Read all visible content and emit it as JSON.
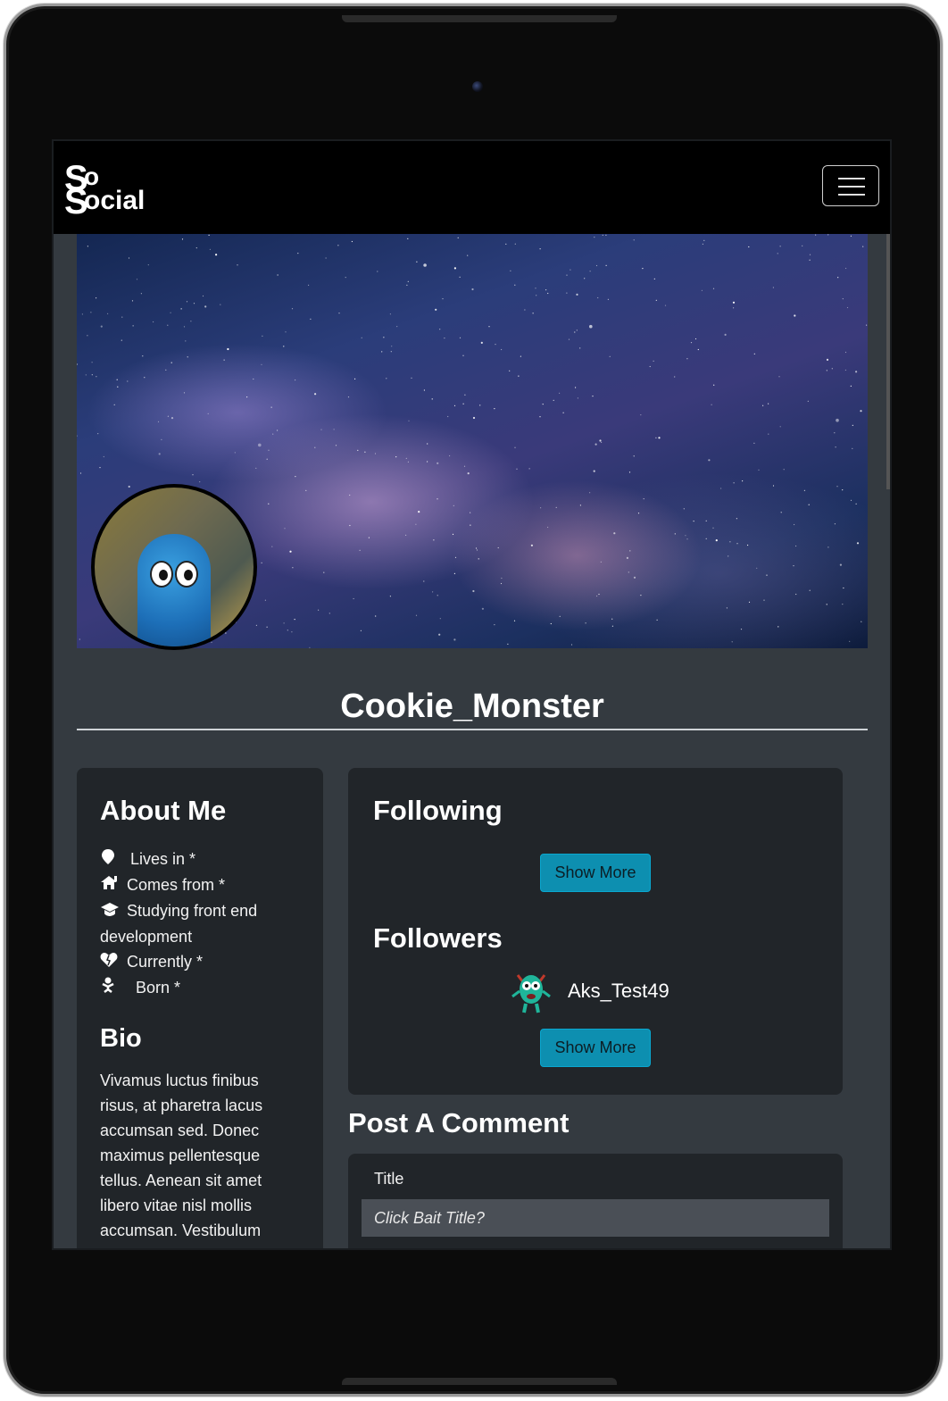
{
  "brand": {
    "logo_alt": "So Social"
  },
  "profile": {
    "username": "Cookie_Monster"
  },
  "about": {
    "title": "About Me",
    "items": [
      {
        "icon": "map-pin-icon",
        "label": "Lives in *"
      },
      {
        "icon": "home-icon",
        "label": "Comes from *"
      },
      {
        "icon": "graduation-cap-icon",
        "label": "Studying front end development"
      },
      {
        "icon": "heart-icon",
        "label": "Currently *"
      },
      {
        "icon": "baby-icon",
        "label": "Born *"
      }
    ],
    "bio_title": "Bio",
    "bio_text": "Vivamus luctus finibus risus, at pharetra lacus accumsan sed. Donec maximus pellentesque tellus. Aenean sit amet libero vitae nisl mollis accumsan. Vestibulum ornare ex eget eros"
  },
  "social": {
    "following_title": "Following",
    "followers_title": "Followers",
    "show_more_label": "Show More",
    "followers": [
      {
        "name": "Aks_Test49"
      }
    ]
  },
  "comment": {
    "section_title": "Post A Comment",
    "title_label": "Title",
    "title_placeholder": "Click Bait Title?"
  },
  "colors": {
    "page_bg": "#343a40",
    "card_bg": "#212529",
    "accent_button": "#0d8fb0",
    "nav_bg": "#000000"
  }
}
